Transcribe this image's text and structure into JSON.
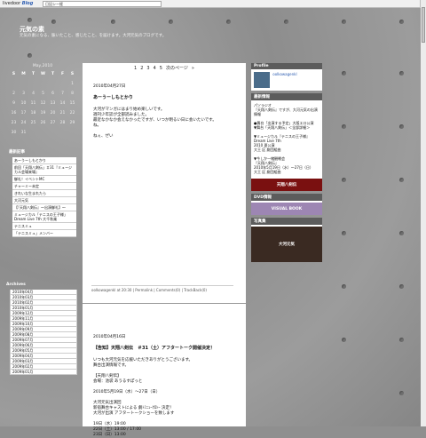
{
  "topbar": {
    "brand_a": "livedoor",
    "brand_b": "Blog",
    "search_value": "日記シー経"
  },
  "blog": {
    "title": "元気の素",
    "subtitle": "元気の素になる、賑いたこと、感じたこと、を届けます。大河元気のブログです。"
  },
  "calendar": {
    "title": "May,2010",
    "headers": [
      "S",
      "M",
      "T",
      "W",
      "T",
      "F",
      "S"
    ],
    "days": [
      "",
      "",
      "",
      "",
      "",
      "",
      "1",
      "2",
      "3",
      "4",
      "5",
      "6",
      "7",
      "8",
      "9",
      "10",
      "11",
      "12",
      "13",
      "14",
      "15",
      "16",
      "17",
      "18",
      "19",
      "20",
      "21",
      "22",
      "23",
      "24",
      "25",
      "26",
      "27",
      "28",
      "29",
      "30",
      "31"
    ]
  },
  "recent": {
    "heading": "最新記事",
    "items": [
      "あーうーしもとかり",
      "前回「天翔八剣伝」＃31『ミュージカル会場来場』",
      "御礼！イベントMC",
      "チャーミー未定",
      "きれいな生まれたら",
      "大河元気",
      "【『天翔八剣伝』～出演御礼】～",
      "ミュージカル「テニスの王子様」Dream Live 7th 大千秋楽",
      "テニスミュ",
      "「テニスミュ」メンバー"
    ]
  },
  "archive": {
    "heading": "Archives",
    "items": [
      "2010年04月",
      "2010年03月",
      "2010年02月",
      "2010年01月",
      "2009年12月",
      "2009年11月",
      "2009年10月",
      "2009年09月",
      "2009年08月",
      "2009年07月",
      "2009年06月",
      "2009年05月",
      "2009年04月",
      "2009年03月",
      "2009年02月",
      "2009年01月"
    ]
  },
  "main": {
    "pager": [
      "1",
      "2",
      "3",
      "4",
      "5",
      "次のページ",
      "»"
    ],
    "post1": {
      "date": "2010年04月27日",
      "title": "あーうーしもとかり",
      "body": [
        "大河がマンガにはまり始め楽しいです。",
        "週刊少年誌が全部読みました。",
        "最近なかなか会えなかったですが、いつか明るい日に会いたいです。",
        "ね。",
        "",
        "ねぇ、ぜい"
      ],
      "footer": "oolkowagenkl at 20:30 | Permalink | Comments(0) | TrackBack(0)"
    },
    "post2": {
      "date": "2010年04月16日",
      "title": "【告知】天翔八剣伝　＃31（土）アフタートーク開催決定！",
      "body": [
        "いつも大河元気を応援いただきありがとうございます。",
        "舞台出演情報です。",
        "",
        "【天翔八剣伝】",
        "会場：池袋 あうるすぽっと",
        "",
        "2010年5月19日（水）～27日（日）",
        "",
        "大河元気出演回",
        "新宿舞台キャストによる 劇ﾄﾐﾆｭｰｸﾛｼｰ 決定！",
        "大河が出演 アフタートークショーを致します",
        "",
        "19日（水）19:00",
        "22日（土）13:00 / 17:00",
        "23日（日）13:00"
      ]
    }
  },
  "right": {
    "profile_heading": "Profile",
    "profile_id": "oolkowagenkl",
    "info_heading": "最新情報",
    "info_lines": [
      "パソラジオ",
      "『天翔八剣伝』ですが、大河元気の出演情報",
      "",
      "●舞台「出演する予定」大阪エロ公演",
      "▼舞台「天翔八剣伝」＜全部詳細＞",
      "",
      "▼ミュージカル『テニスの王子様』",
      "Dream Live 7th",
      "2010 夏公演",
      "大王 区 劇団組曲",
      "",
      "▼今しか一緒観戦会",
      "『天翔八剣伝』",
      "2010年5月19日（水）～27日（日）",
      "大王 区 劇団組曲"
    ],
    "banner1": "天翔八剣伝",
    "dvd_heading": "DVD情報",
    "banner2": "VISUAL BOOK",
    "photo_heading": "写真集",
    "photo_caption": "大河元気"
  },
  "colors": {
    "bg": "#8f8f8f",
    "box_header": "#5c5c5c",
    "link": "#2a5bb0"
  }
}
